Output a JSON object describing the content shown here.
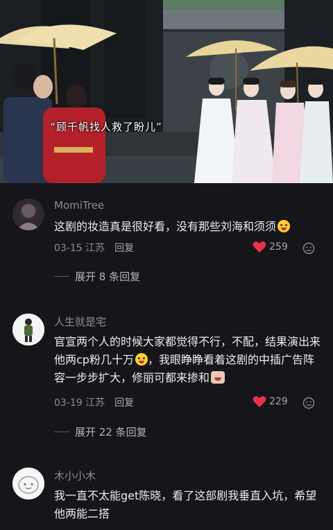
{
  "video": {
    "subtitle": "“顾千帆找人救了盼儿”"
  },
  "comments": [
    {
      "username": "MomiTree",
      "text": "这剧的妆造真是很好看，没有那些刘海和须须",
      "emoji": "laughing-crying-emoji",
      "date": "03-15",
      "location": "江苏",
      "reply_label": "回复",
      "likes": "259",
      "expand_label": "展开 8 条回复"
    },
    {
      "username": "人生就是宅",
      "text_part1": "官宣两个人的时候大家都觉得不行，不配，结果演出来他两cp粉几十万",
      "text_part2": "，我眼睁睁看着这剧的中插广告阵容一步步扩大，修丽可都来掺和",
      "emoji1": "laughing-crying-emoji",
      "emoji2": "screaming-emoji",
      "date": "03-19",
      "location": "江苏",
      "reply_label": "回复",
      "likes": "229",
      "expand_label": "展开 22 条回复"
    },
    {
      "username": "木小小木",
      "text": "我一直不太能get陈晓，看了这部剧我垂直入坑，希望他两能二搭"
    }
  ],
  "colors": {
    "background": "#16161a",
    "like_heart": "#e8334a",
    "muted_text": "#8c8c94"
  }
}
